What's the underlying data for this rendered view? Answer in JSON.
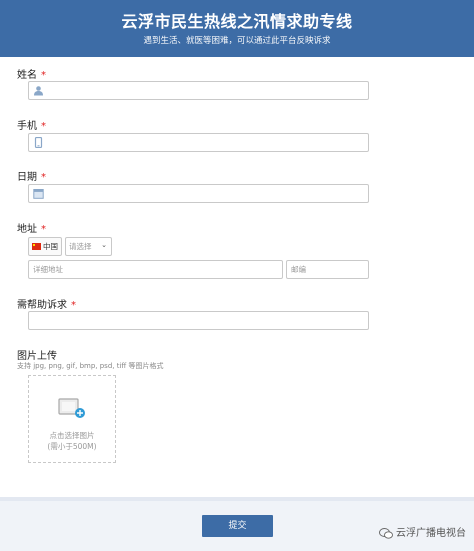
{
  "header": {
    "title": "云浮市民生热线之汛情求助专线",
    "subtitle": "遇到生活、就医等困难，可以通过此平台反映诉求",
    "background_color": "#3d6ca6"
  },
  "form": {
    "required_mark": "*",
    "name": {
      "label": "姓名",
      "value": "",
      "icon": "user-icon"
    },
    "phone": {
      "label": "手机",
      "value": "",
      "icon": "phone-icon"
    },
    "date": {
      "label": "日期",
      "value": "",
      "icon": "calendar-icon"
    },
    "address": {
      "label": "地址",
      "country": "中国",
      "country_flag": "china-flag-icon",
      "region_select": "请选择",
      "detail_placeholder": "详细地址",
      "zip_placeholder": "邮编"
    },
    "request": {
      "label": "需帮助诉求",
      "value": ""
    },
    "image_upload": {
      "label": "图片上传",
      "hint": "支持 jpg, png, gif, bmp, psd, tiff 等图片格式",
      "button_line1": "点击选择图片",
      "button_line2": "(需小于500M)"
    }
  },
  "submit_label": "提交",
  "watermark": "云浮广播电视台"
}
